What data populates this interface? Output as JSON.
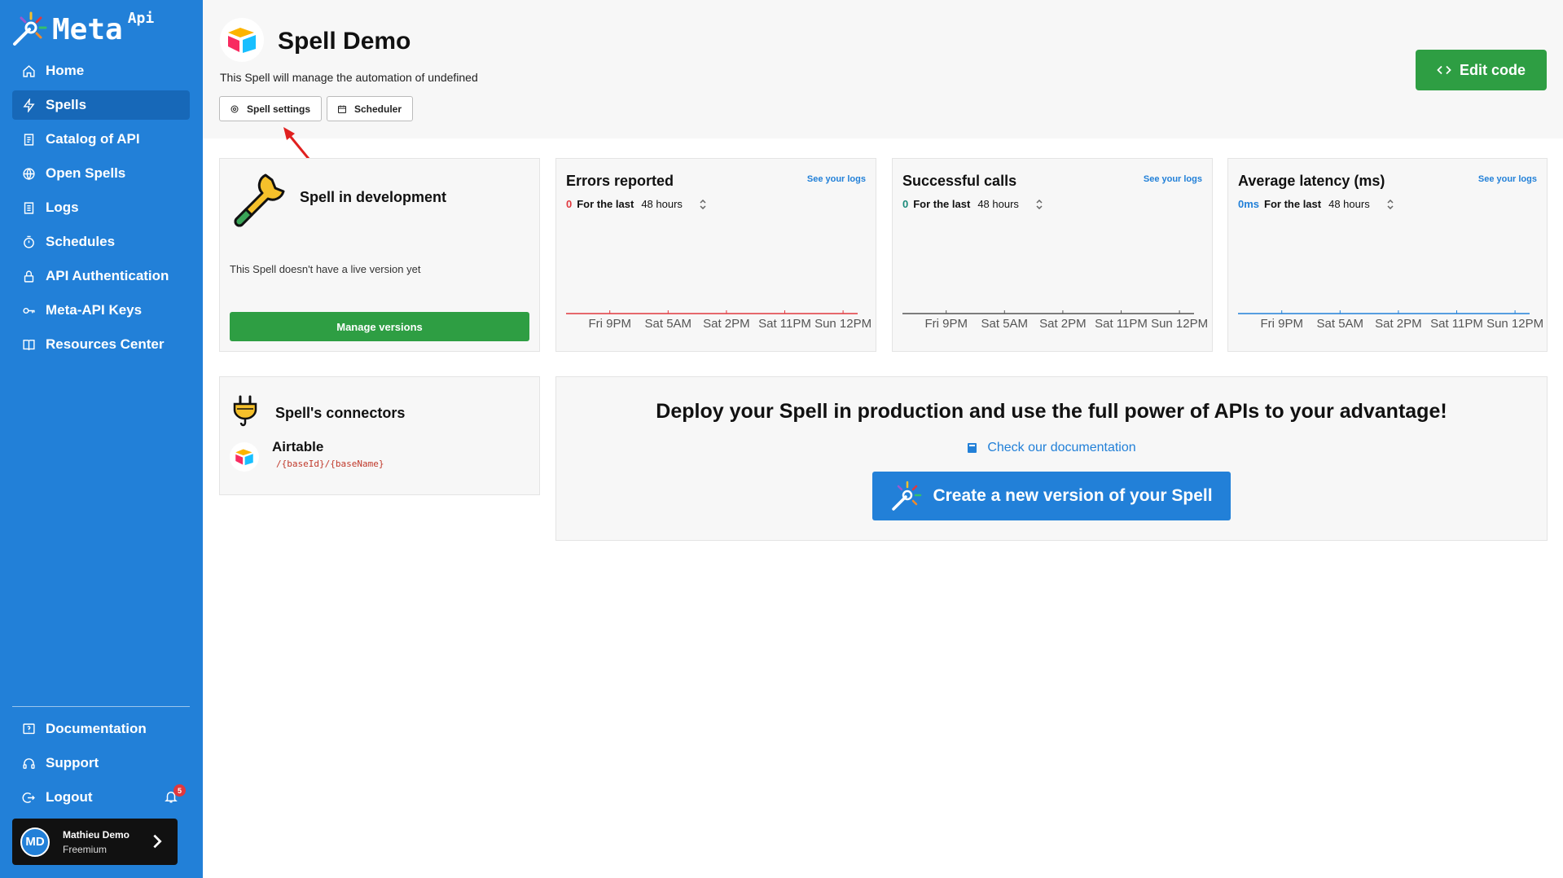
{
  "brand": {
    "name": "Meta",
    "superscript": "Api"
  },
  "sidebar": {
    "items": [
      {
        "label": "Home",
        "icon": "home-icon"
      },
      {
        "label": "Spells",
        "icon": "bolt-icon",
        "active": true
      },
      {
        "label": "Catalog of API",
        "icon": "catalog-icon"
      },
      {
        "label": "Open Spells",
        "icon": "globe-icon"
      },
      {
        "label": "Logs",
        "icon": "logs-icon"
      },
      {
        "label": "Schedules",
        "icon": "timer-icon"
      },
      {
        "label": "API Authentication",
        "icon": "lock-icon"
      },
      {
        "label": "Meta-API Keys",
        "icon": "key-icon"
      },
      {
        "label": "Resources Center",
        "icon": "book-icon"
      }
    ],
    "bottom_items": [
      {
        "label": "Documentation",
        "icon": "help-icon"
      },
      {
        "label": "Support",
        "icon": "headset-icon"
      },
      {
        "label": "Logout",
        "icon": "logout-icon"
      }
    ],
    "notifications_count": "5",
    "user": {
      "initials": "MD",
      "name": "Mathieu Demo",
      "plan": "Freemium"
    }
  },
  "header": {
    "title": "Spell Demo",
    "description": "This Spell will manage the automation of undefined",
    "tabs": {
      "settings": "Spell settings",
      "scheduler": "Scheduler"
    },
    "edit_label": "Edit code"
  },
  "dev_card": {
    "title": "Spell in development",
    "text": "This Spell doesn't have a live version yet",
    "button": "Manage versions"
  },
  "stats": [
    {
      "title": "Errors reported",
      "logs": "See your logs",
      "value": "0",
      "value_color": "#e0383e",
      "for_label": "For the last",
      "period": "48 hours",
      "line_color": "#e0383e"
    },
    {
      "title": "Successful calls",
      "logs": "See your logs",
      "value": "0",
      "value_color": "#1a8a7a",
      "for_label": "For the last",
      "period": "48 hours",
      "line_color": "#555555"
    },
    {
      "title": "Average latency (ms)",
      "logs": "See your logs",
      "value": "0ms",
      "value_color": "#2280d8",
      "for_label": "For the last",
      "period": "48 hours",
      "line_color": "#2280d8"
    }
  ],
  "chart_ticks": [
    "Fri 9PM",
    "Sat 5AM",
    "Sat 2PM",
    "Sat 11PM",
    "Sun 12PM"
  ],
  "connectors": {
    "title": "Spell's connectors",
    "name": "Airtable",
    "path": "/{baseId}/{baseName}"
  },
  "deploy": {
    "title": "Deploy your Spell in production and use the full power of APIs to your advantage!",
    "doc_link": "Check our documentation",
    "button": "Create a new version of your Spell"
  },
  "colors": {
    "sidebar": "#2280d8",
    "green": "#2e9e43",
    "accent": "#2280d8"
  }
}
